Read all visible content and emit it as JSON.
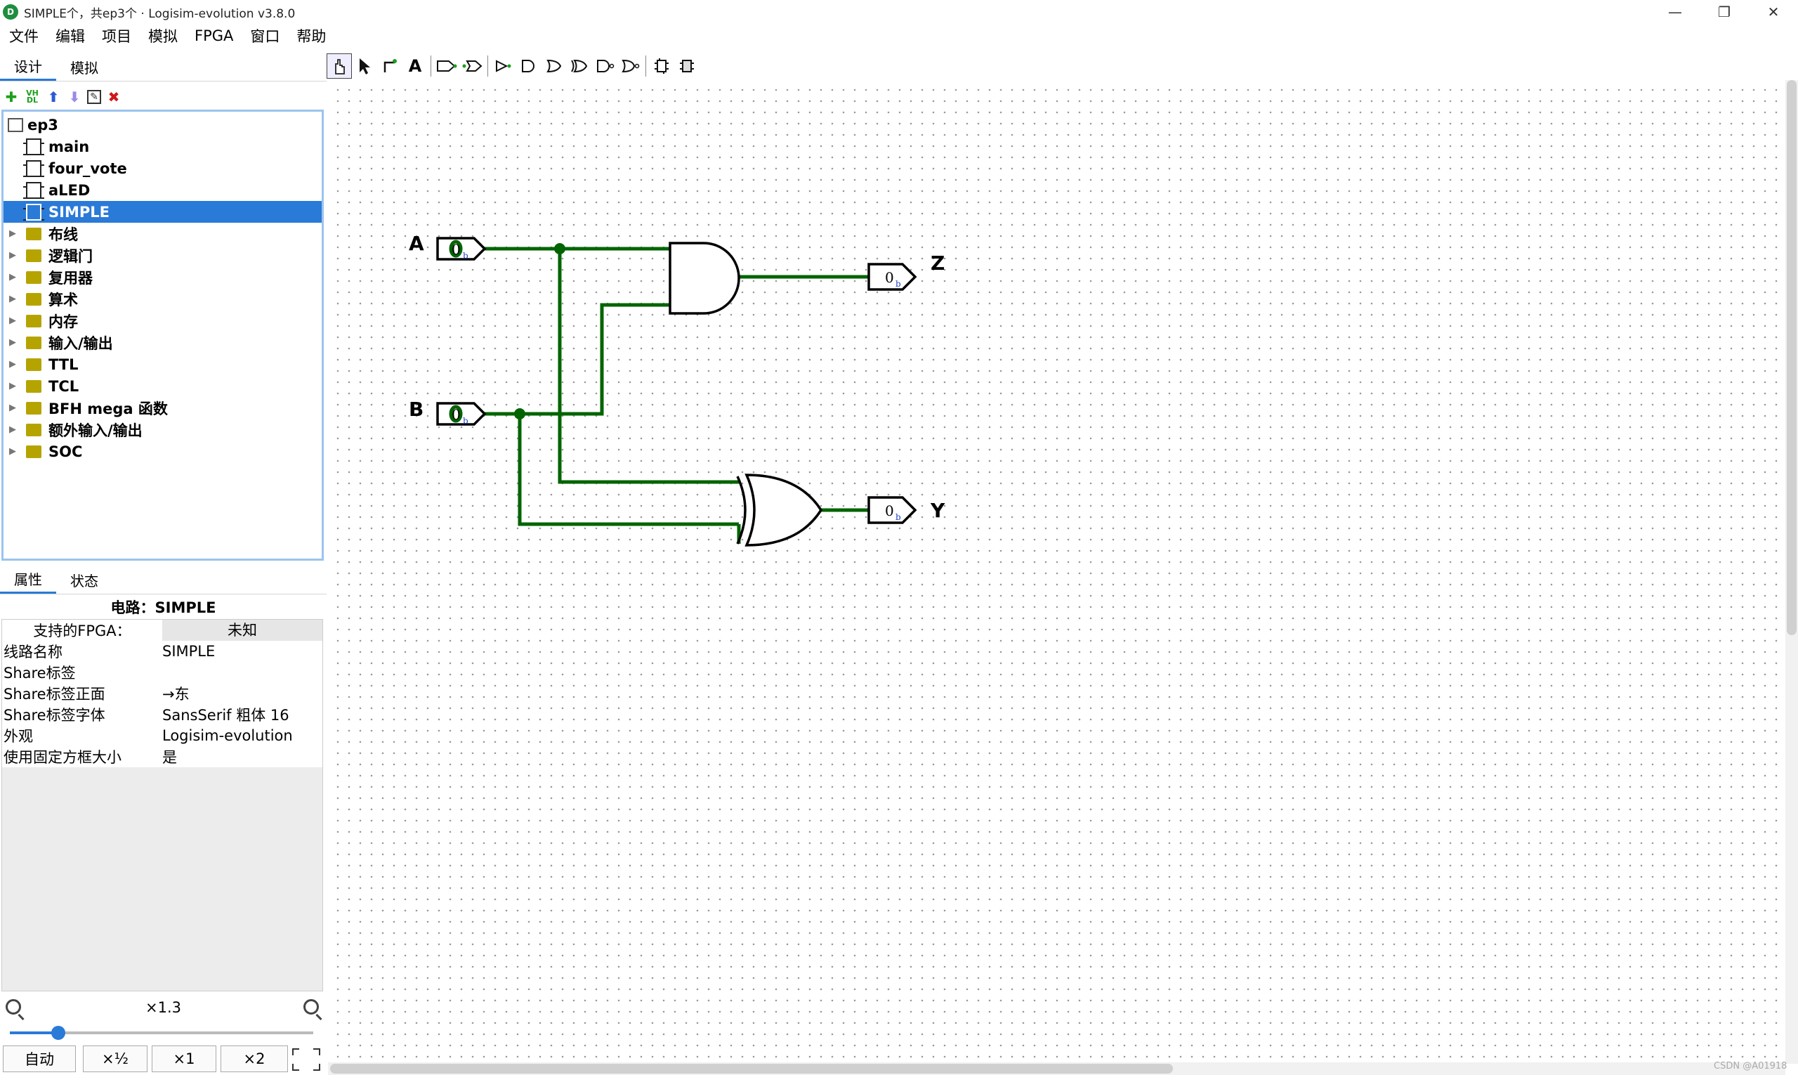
{
  "window": {
    "title": "SIMPLE个，共ep3个 · Logisim-evolution v3.8.0",
    "icon_letters": "D",
    "minimize": "—",
    "maximize": "❐",
    "close": "✕"
  },
  "menu": [
    "文件",
    "编辑",
    "项目",
    "模拟",
    "FPGA",
    "窗口",
    "帮助"
  ],
  "left_tabs": [
    "设计",
    "模拟"
  ],
  "tree_toolbar": {
    "add": "✚",
    "vhdl": "VH DL",
    "up": "⬆",
    "down": "⬇",
    "edit": "✎",
    "delete": "✖"
  },
  "tree": {
    "project": "ep3",
    "circuits": [
      "main",
      "four_vote",
      "aLED",
      "SIMPLE"
    ],
    "selected": "SIMPLE",
    "libraries": [
      "布线",
      "逻辑门",
      "复用器",
      "算术",
      "内存",
      "输入/输出",
      "TTL",
      "TCL",
      "BFH mega 函数",
      "额外输入/输出",
      "SOC"
    ]
  },
  "attr_tabs": [
    "属性",
    "状态"
  ],
  "attributes": {
    "title": "电路：SIMPLE",
    "fpga": {
      "key": "支持的FPGA：",
      "value": "未知"
    },
    "rows": [
      {
        "key": "线路名称",
        "value": "SIMPLE"
      },
      {
        "key": "Share标签",
        "value": ""
      },
      {
        "key": "Share标签正面",
        "value": "→东"
      },
      {
        "key": "Share标签字体",
        "value": "SansSerif 粗体 16"
      },
      {
        "key": "外观",
        "value": "Logisim-evolution"
      },
      {
        "key": "使用固定方框大小",
        "value": "是"
      }
    ]
  },
  "zoom": {
    "label": "×1.3",
    "level": 0.16,
    "buttons": [
      "自动",
      "×½",
      "×1",
      "×2"
    ]
  },
  "toolbar_icons": [
    "hand-poke-icon",
    "select-arrow-icon",
    "wiring-icon",
    "text-tool-icon",
    "input-pin-icon",
    "output-pin-icon",
    "buffer-icon",
    "and-gate-icon",
    "or-gate-icon",
    "xor-gate-icon",
    "not-gate-icon",
    "nand-gate-icon",
    "circuit-layout-icon",
    "circuit-appearance-icon"
  ],
  "text_tool": "A",
  "circuit": {
    "inputs": [
      {
        "label": "A",
        "value": "0",
        "sub": "b"
      },
      {
        "label": "B",
        "value": "0",
        "sub": "b"
      }
    ],
    "outputs": [
      {
        "label": "Z",
        "value": "0",
        "sub": "b"
      },
      {
        "label": "Y",
        "value": "0",
        "sub": "b"
      }
    ]
  },
  "colors": {
    "accent": "#2a7ad8",
    "wire": "#006400"
  },
  "watermark": "CSDN @A01918"
}
